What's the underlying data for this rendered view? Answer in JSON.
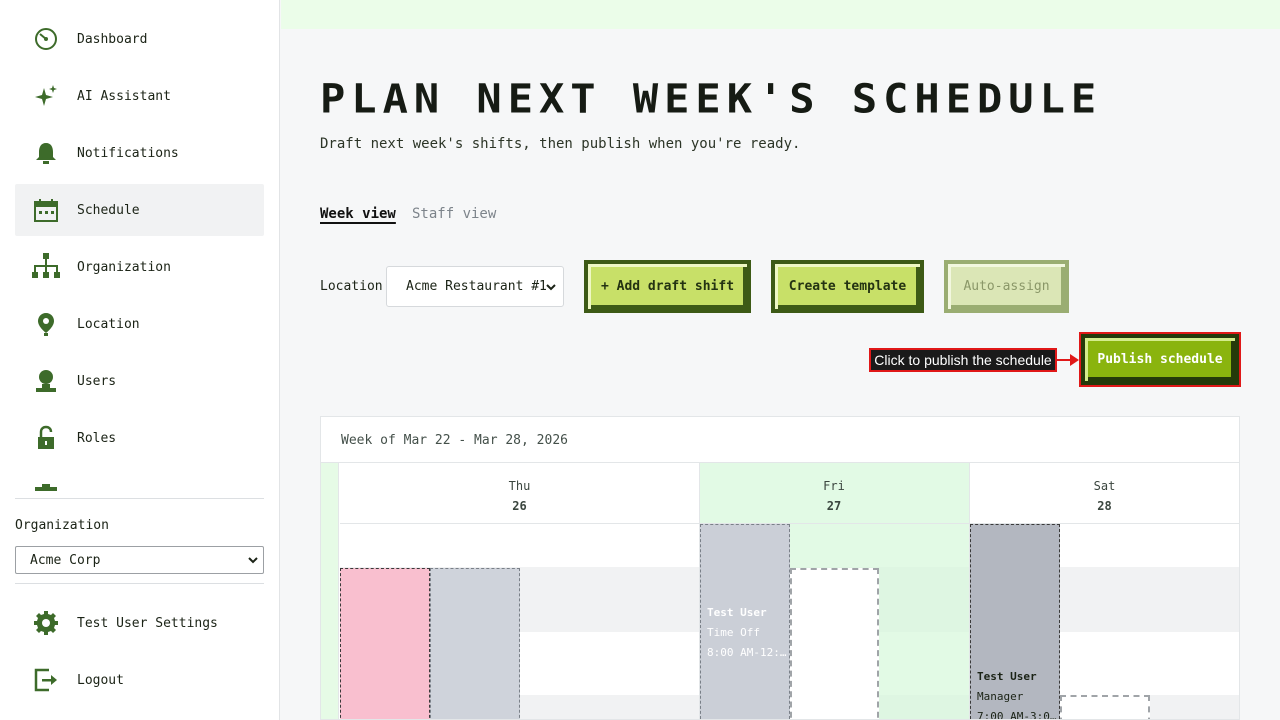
{
  "sidebar": {
    "items": [
      {
        "label": "Dashboard",
        "icon": "dashboard-icon"
      },
      {
        "label": "AI Assistant",
        "icon": "sparkle-icon"
      },
      {
        "label": "Notifications",
        "icon": "bell-icon"
      },
      {
        "label": "Schedule",
        "icon": "calendar-icon"
      },
      {
        "label": "Organization",
        "icon": "org-chart-icon"
      },
      {
        "label": "Location",
        "icon": "location-pin-icon"
      },
      {
        "label": "Users",
        "icon": "user-icon"
      },
      {
        "label": "Roles",
        "icon": "lock-icon"
      }
    ],
    "organization_label": "Organization",
    "organization_value": "Acme Corp",
    "settings_label": "Test User Settings",
    "logout_label": "Logout"
  },
  "page": {
    "title": "Plan next week's schedule",
    "subtitle": "Draft next week's shifts, then publish when you're ready."
  },
  "tabs": {
    "week": "Week view",
    "staff": "Staff view"
  },
  "toolbar": {
    "location_label": "Location",
    "location_value": "Acme Restaurant #1",
    "add_draft_shift": "+ Add draft shift",
    "create_template": "Create template",
    "auto_assign": "Auto-assign",
    "publish": "Publish schedule",
    "callout": "Click to publish the schedule"
  },
  "calendar": {
    "week_title": "Week of Mar 22 - Mar 28, 2026",
    "days": [
      {
        "name": "Thu",
        "date": "26"
      },
      {
        "name": "Fri",
        "date": "27"
      },
      {
        "name": "Sat",
        "date": "28"
      }
    ],
    "shifts": [
      {
        "user": "Test User",
        "role": "Time Off",
        "time": "8:00 AM-12:…"
      },
      {
        "user": "Test User",
        "role": "Manager",
        "time": "7:00 AM-3:0…"
      }
    ]
  },
  "colors": {
    "accent": "#8ab40e",
    "button": "#c8e068",
    "button_border": "#3d5a16",
    "today_column": "#e6fbe6",
    "time_off": "#f9bfcf",
    "shift_gray": "#cfd3db",
    "highlight": "#e01818"
  }
}
